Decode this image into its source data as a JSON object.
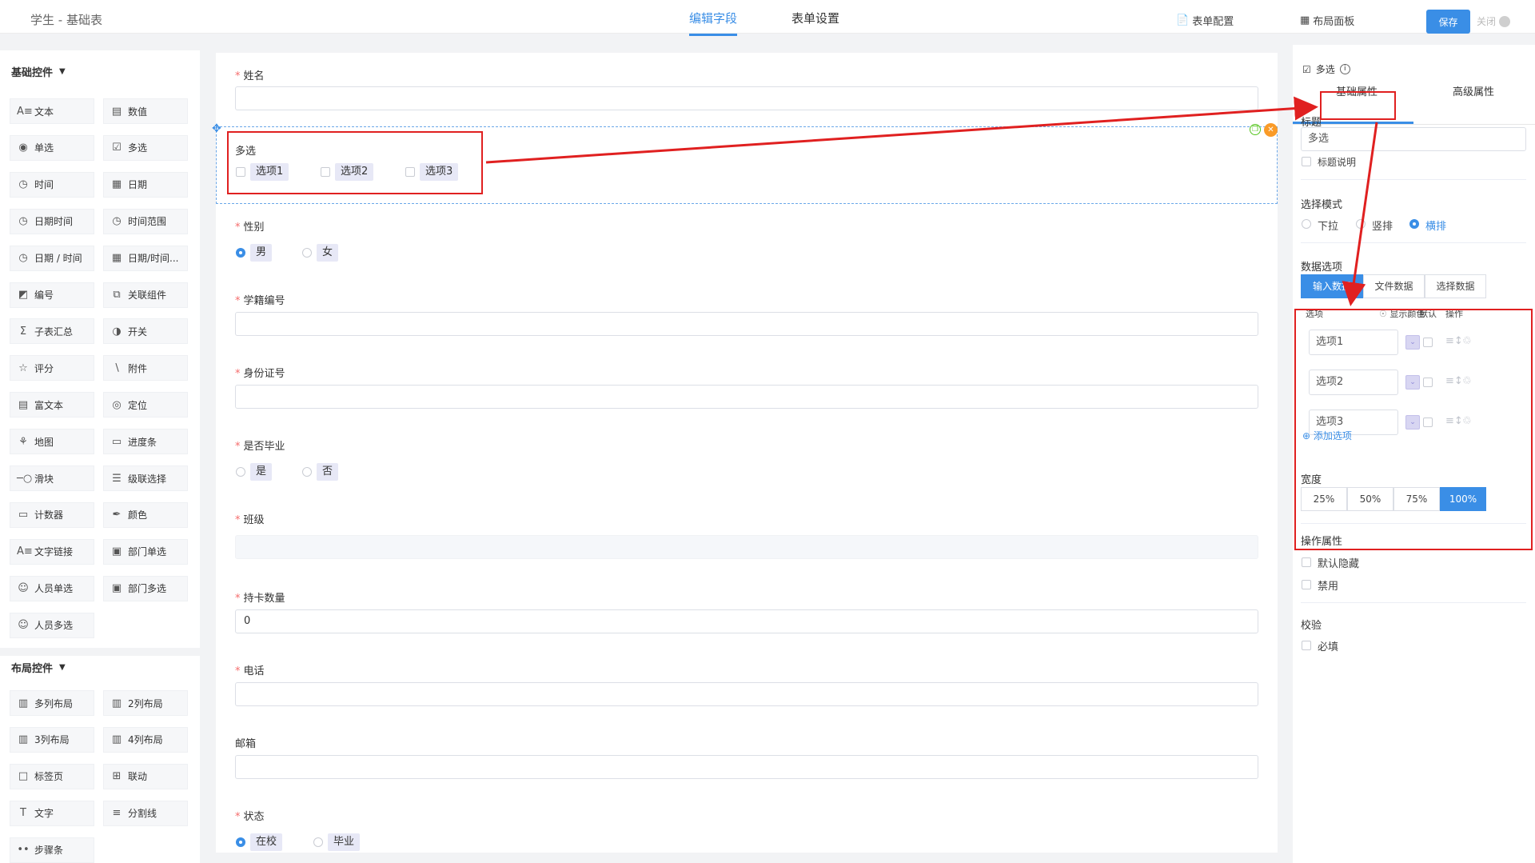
{
  "header": {
    "app_title": "学生 - 基础表",
    "tabs": [
      {
        "label": "编辑字段"
      },
      {
        "label": "表单设置"
      }
    ],
    "form_config": "表单配置",
    "layout_panel": "布局面板",
    "save": "保存",
    "close": "关闭"
  },
  "colors": {
    "accent": "#3a8ee6",
    "annotation": "#e02020",
    "required": "#f56c6c"
  },
  "left_panel": {
    "basic_title": "基础控件",
    "basic": [
      {
        "label": "文本",
        "icon": "text-icon"
      },
      {
        "label": "数值",
        "icon": "number-icon"
      },
      {
        "label": "单选",
        "icon": "radio-icon"
      },
      {
        "label": "多选",
        "icon": "checkbox-icon"
      },
      {
        "label": "时间",
        "icon": "clock-icon"
      },
      {
        "label": "日期",
        "icon": "calendar-icon"
      },
      {
        "label": "日期时间",
        "icon": "clock-icon"
      },
      {
        "label": "时间范围",
        "icon": "clock-icon"
      },
      {
        "label": "日期 / 时间",
        "icon": "clock-icon"
      },
      {
        "label": "日期/时间...",
        "icon": "calendar-icon"
      },
      {
        "label": "编号",
        "icon": "serial-icon"
      },
      {
        "label": "关联组件",
        "icon": "link-icon"
      },
      {
        "label": "子表汇总",
        "icon": "sigma-icon"
      },
      {
        "label": "开关",
        "icon": "toggle-icon"
      },
      {
        "label": "评分",
        "icon": "star-icon"
      },
      {
        "label": "附件",
        "icon": "paperclip-icon"
      },
      {
        "label": "富文本",
        "icon": "richtext-icon"
      },
      {
        "label": "定位",
        "icon": "location-icon"
      },
      {
        "label": "地图",
        "icon": "map-icon"
      },
      {
        "label": "进度条",
        "icon": "progress-icon"
      },
      {
        "label": "滑块",
        "icon": "slider-icon"
      },
      {
        "label": "级联选择",
        "icon": "cascade-icon"
      },
      {
        "label": "计数器",
        "icon": "counter-icon"
      },
      {
        "label": "颜色",
        "icon": "color-picker-icon"
      },
      {
        "label": "文字链接",
        "icon": "text-link-icon"
      },
      {
        "label": "部门单选",
        "icon": "department-icon"
      },
      {
        "label": "人员单选",
        "icon": "user-icon"
      },
      {
        "label": "部门多选",
        "icon": "department-icon"
      },
      {
        "label": "人员多选",
        "icon": "users-icon"
      }
    ],
    "layout_title": "布局控件",
    "layout": [
      {
        "label": "多列布局",
        "icon": "columns-icon"
      },
      {
        "label": "2列布局",
        "icon": "columns-icon"
      },
      {
        "label": "3列布局",
        "icon": "columns-icon"
      },
      {
        "label": "4列布局",
        "icon": "columns-icon"
      },
      {
        "label": "标签页",
        "icon": "tabs-icon"
      },
      {
        "label": "联动",
        "icon": "grid-icon"
      },
      {
        "label": "文字",
        "icon": "text-t-icon"
      },
      {
        "label": "分割线",
        "icon": "divider-icon"
      },
      {
        "label": "步骤条",
        "icon": "steps-icon"
      }
    ]
  },
  "form": {
    "name_label": "姓名",
    "multi_label": "多选",
    "multi_options": [
      "选项1",
      "选项2",
      "选项3"
    ],
    "gender_label": "性别",
    "gender_options": [
      "男",
      "女"
    ],
    "student_no_label": "学籍编号",
    "id_card_label": "身份证号",
    "graduated_label": "是否毕业",
    "graduated_options": [
      "是",
      "否"
    ],
    "class_label": "班级",
    "card_count_label": "持卡数量",
    "card_count_value": "0",
    "phone_label": "电话",
    "email_label": "邮箱",
    "status_label": "状态",
    "status_options": [
      "在校",
      "毕业"
    ]
  },
  "props": {
    "title": "多选",
    "tabs": [
      "基础属性",
      "高级属性"
    ],
    "title_label": "标题",
    "title_value": "多选",
    "title_desc": "标题说明",
    "mode_label": "选择模式",
    "modes": [
      "下拉",
      "竖排",
      "横排"
    ],
    "data_label": "数据选项",
    "data_tabs": [
      "输入数据",
      "文件数据",
      "选择数据"
    ],
    "col_option": "选项",
    "col_color": "显示颜色",
    "col_default": "默认",
    "col_action": "操作",
    "options": [
      "选项1",
      "选项2",
      "选项3"
    ],
    "add_option": "添加选项",
    "width_label": "宽度",
    "widths": [
      "25%",
      "50%",
      "75%",
      "100%"
    ],
    "action_label": "操作属性",
    "hide_default": "默认隐藏",
    "disabled": "禁用",
    "validate_label": "校验",
    "required": "必填"
  }
}
